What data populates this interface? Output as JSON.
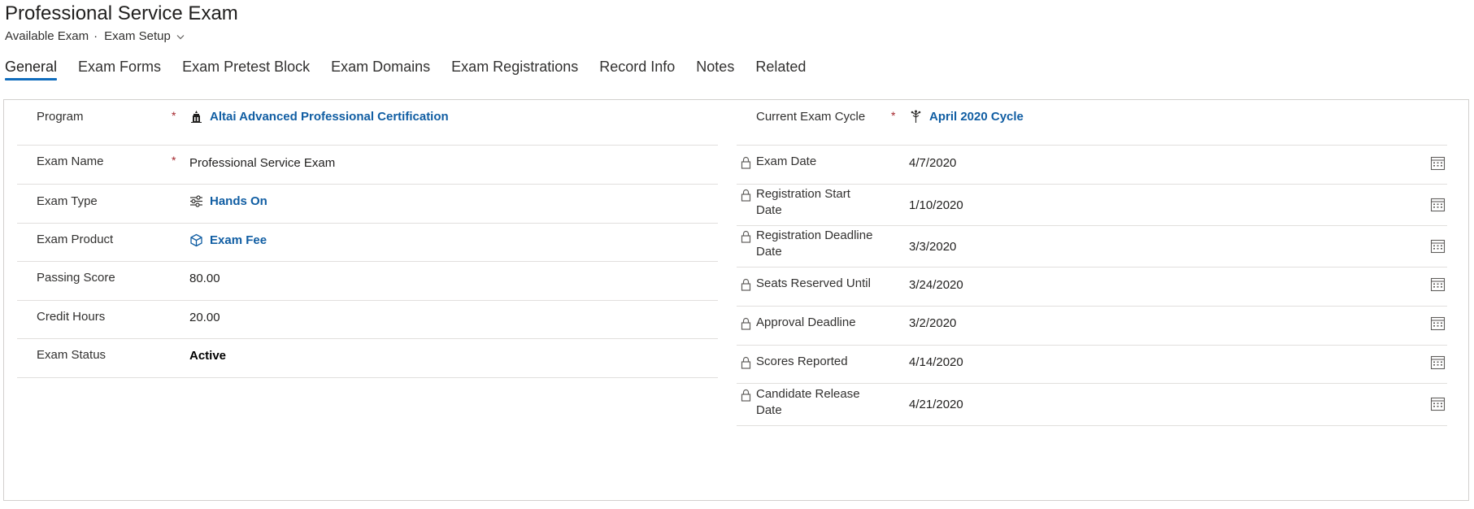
{
  "header": {
    "title": "Professional Service Exam",
    "entity": "Available Exam",
    "separator": "·",
    "form_selector": "Exam Setup"
  },
  "tabs": [
    {
      "label": "General",
      "active": true
    },
    {
      "label": "Exam Forms"
    },
    {
      "label": "Exam Pretest Block"
    },
    {
      "label": "Exam Domains"
    },
    {
      "label": "Exam Registrations"
    },
    {
      "label": "Record Info"
    },
    {
      "label": "Notes"
    },
    {
      "label": "Related"
    }
  ],
  "left_fields": {
    "program": {
      "label": "Program",
      "required": "*",
      "value": "Altai Advanced Professional Certification",
      "icon": "building-icon"
    },
    "exam_name": {
      "label": "Exam Name",
      "required": "*",
      "value": "Professional Service Exam"
    },
    "exam_type": {
      "label": "Exam Type",
      "value": "Hands On",
      "icon": "sliders-icon"
    },
    "exam_product": {
      "label": "Exam Product",
      "value": "Exam Fee",
      "icon": "cube-icon"
    },
    "passing_score": {
      "label": "Passing Score",
      "value": "80.00"
    },
    "credit_hours": {
      "label": "Credit Hours",
      "value": "20.00"
    },
    "exam_status": {
      "label": "Exam Status",
      "value": "Active"
    }
  },
  "right_fields": {
    "current_cycle": {
      "label": "Current Exam Cycle",
      "required": "*",
      "value": "April 2020 Cycle",
      "icon": "cycle-icon"
    },
    "dates": [
      {
        "label": "Exam Date",
        "value": "4/7/2020"
      },
      {
        "label": "Registration Start Date",
        "value": "1/10/2020"
      },
      {
        "label": "Registration Deadline Date",
        "value": "3/3/2020"
      },
      {
        "label": "Seats Reserved Until",
        "value": "3/24/2020"
      },
      {
        "label": "Approval Deadline",
        "value": "3/2/2020"
      },
      {
        "label": "Scores Reported",
        "value": "4/14/2020"
      },
      {
        "label": "Candidate Release Date",
        "value": "4/21/2020"
      }
    ]
  },
  "colors": {
    "accent": "#0f6cbd",
    "link": "#115ea3",
    "required": "#a4262c",
    "border": "#d2d0ce"
  }
}
